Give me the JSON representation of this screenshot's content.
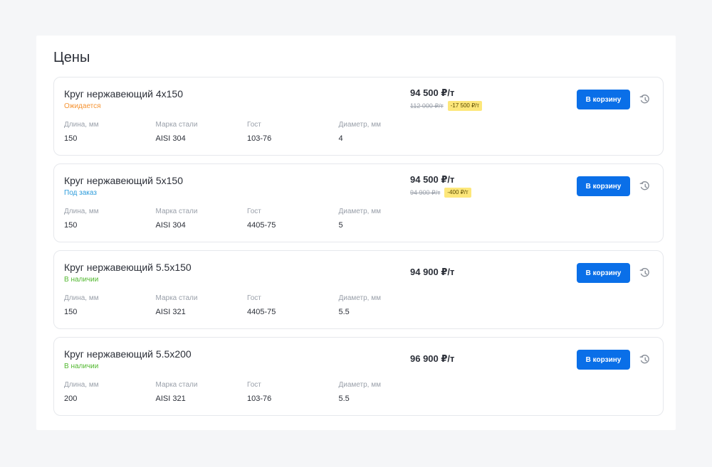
{
  "section": {
    "title": "Цены"
  },
  "products": [
    {
      "name": "Круг нержавеющий 4х150",
      "status": "Ожидается",
      "status_color": "#f59332",
      "price": "94 500 ₽/т",
      "old_price": "112 000 ₽/т",
      "discount": "-17 500 ₽/т",
      "props": [
        {
          "label": "Длина, мм",
          "value": "150"
        },
        {
          "label": "Марка стали",
          "value": "AISI 304"
        },
        {
          "label": "Гост",
          "value": "103-76"
        },
        {
          "label": "Диаметр, мм",
          "value": "4"
        }
      ],
      "cart_label": "В корзину",
      "history_icon": "history-icon"
    },
    {
      "name": "Круг нержавеющий 5х150",
      "status": "Под заказ",
      "status_color": "#2d9cdb",
      "price": "94 500 ₽/т",
      "old_price": "94 900 ₽/т",
      "discount": "-400 ₽/т",
      "props": [
        {
          "label": "Длина, мм",
          "value": "150"
        },
        {
          "label": "Марка стали",
          "value": "AISI 304"
        },
        {
          "label": "Гост",
          "value": "4405-75"
        },
        {
          "label": "Диаметр, мм",
          "value": "5"
        }
      ],
      "cart_label": "В корзину",
      "history_icon": "history-icon"
    },
    {
      "name": "Круг нержавеющий 5.5х150",
      "status": "В наличии",
      "status_color": "#52b830",
      "price": "94 900 ₽/т",
      "props": [
        {
          "label": "Длина, мм",
          "value": "150"
        },
        {
          "label": "Марка стали",
          "value": "AISI 321"
        },
        {
          "label": "Гост",
          "value": "4405-75"
        },
        {
          "label": "Диаметр, мм",
          "value": "5.5"
        }
      ],
      "cart_label": "В корзину",
      "history_icon": "history-icon"
    },
    {
      "name": "Круг нержавеющий 5.5х200",
      "status": "В наличии",
      "status_color": "#52b830",
      "price": "96 900 ₽/т",
      "props": [
        {
          "label": "Длина, мм",
          "value": "200"
        },
        {
          "label": "Марка стали",
          "value": "AISI 321"
        },
        {
          "label": "Гост",
          "value": "103-76"
        },
        {
          "label": "Диаметр, мм",
          "value": "5.5"
        }
      ],
      "cart_label": "В корзину",
      "history_icon": "history-icon"
    }
  ],
  "colors": {
    "accent": "#0a6fe8",
    "discount_bg": "#fde77a",
    "page_bg": "#f5f6f8"
  }
}
